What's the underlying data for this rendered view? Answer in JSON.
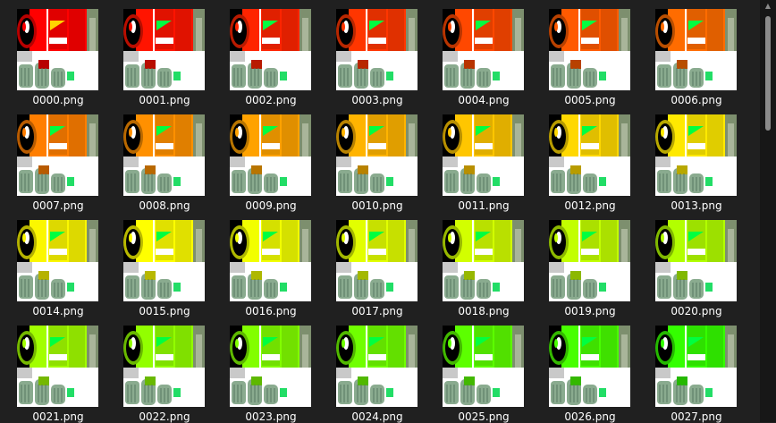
{
  "files": [
    {
      "name": "0000.png",
      "color": "#ff0000"
    },
    {
      "name": "0001.png",
      "color": "#ff1400"
    },
    {
      "name": "0002.png",
      "color": "#ff2400"
    },
    {
      "name": "0003.png",
      "color": "#ff3600"
    },
    {
      "name": "0004.png",
      "color": "#ff4800"
    },
    {
      "name": "0005.png",
      "color": "#ff5a00"
    },
    {
      "name": "0006.png",
      "color": "#ff6c00"
    },
    {
      "name": "0007.png",
      "color": "#ff7e00"
    },
    {
      "name": "0008.png",
      "color": "#ff9000"
    },
    {
      "name": "0009.png",
      "color": "#ffa200"
    },
    {
      "name": "0010.png",
      "color": "#ffb400"
    },
    {
      "name": "0011.png",
      "color": "#ffc600"
    },
    {
      "name": "0012.png",
      "color": "#ffd800"
    },
    {
      "name": "0013.png",
      "color": "#ffe900"
    },
    {
      "name": "0014.png",
      "color": "#fbf700"
    },
    {
      "name": "0015.png",
      "color": "#ffff00"
    },
    {
      "name": "0016.png",
      "color": "#f2ff00"
    },
    {
      "name": "0017.png",
      "color": "#e2ff00"
    },
    {
      "name": "0018.png",
      "color": "#d2ff00"
    },
    {
      "name": "0019.png",
      "color": "#c2ff00"
    },
    {
      "name": "0020.png",
      "color": "#b2ff00"
    },
    {
      "name": "0021.png",
      "color": "#a2ff00"
    },
    {
      "name": "0022.png",
      "color": "#92ff00"
    },
    {
      "name": "0023.png",
      "color": "#82ff00"
    },
    {
      "name": "0024.png",
      "color": "#70ff00"
    },
    {
      "name": "0025.png",
      "color": "#5cff00"
    },
    {
      "name": "0026.png",
      "color": "#48ff00"
    },
    {
      "name": "0027.png",
      "color": "#34ff00"
    }
  ],
  "scrollbar": {
    "up_icon": "chevron-up-icon"
  }
}
